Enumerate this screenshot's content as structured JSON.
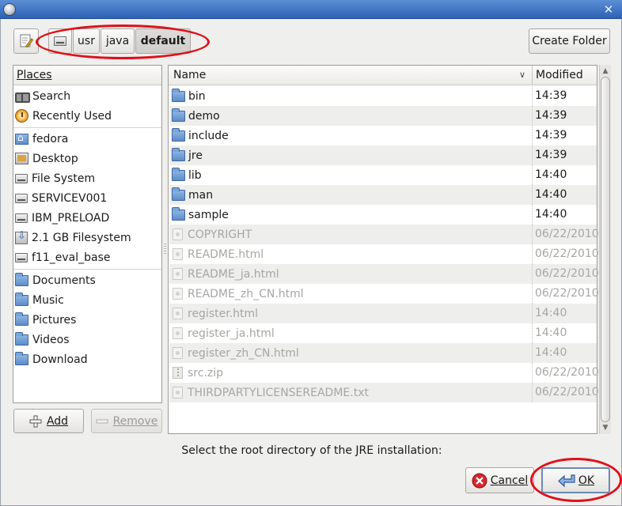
{
  "path_bar": {
    "segments": [
      "usr",
      "java",
      "default"
    ],
    "active": "default"
  },
  "toolbar": {
    "create_folder_label": "Create Folder"
  },
  "places": {
    "header": "Places",
    "items": [
      {
        "label": "Search",
        "icon": "search-icon"
      },
      {
        "label": "Recently Used",
        "icon": "recently-used-icon"
      },
      {
        "label": "fedora",
        "icon": "home-folder-icon"
      },
      {
        "label": "Desktop",
        "icon": "desktop-icon"
      },
      {
        "label": "File System",
        "icon": "drive-icon"
      },
      {
        "label": "SERVICEV001",
        "icon": "drive-icon"
      },
      {
        "label": "IBM_PRELOAD",
        "icon": "drive-icon"
      },
      {
        "label": "2.1 GB Filesystem",
        "icon": "removable-drive-icon"
      },
      {
        "label": "f11_eval_base",
        "icon": "drive-icon"
      },
      {
        "label": "Documents",
        "icon": "folder-icon"
      },
      {
        "label": "Music",
        "icon": "folder-icon"
      },
      {
        "label": "Pictures",
        "icon": "folder-icon"
      },
      {
        "label": "Videos",
        "icon": "folder-icon"
      },
      {
        "label": "Download",
        "icon": "folder-icon"
      }
    ],
    "add_label": "Add",
    "remove_label": "Remove"
  },
  "files": {
    "columns": {
      "name": "Name",
      "modified": "Modified"
    },
    "rows": [
      {
        "name": "bin",
        "modified": "14:39",
        "type": "folder"
      },
      {
        "name": "demo",
        "modified": "14:39",
        "type": "folder"
      },
      {
        "name": "include",
        "modified": "14:39",
        "type": "folder"
      },
      {
        "name": "jre",
        "modified": "14:39",
        "type": "folder"
      },
      {
        "name": "lib",
        "modified": "14:40",
        "type": "folder"
      },
      {
        "name": "man",
        "modified": "14:40",
        "type": "folder"
      },
      {
        "name": "sample",
        "modified": "14:40",
        "type": "folder"
      },
      {
        "name": "COPYRIGHT",
        "modified": "06/22/2010",
        "type": "file"
      },
      {
        "name": "README.html",
        "modified": "06/22/2010",
        "type": "file"
      },
      {
        "name": "README_ja.html",
        "modified": "06/22/2010",
        "type": "file"
      },
      {
        "name": "README_zh_CN.html",
        "modified": "06/22/2010",
        "type": "file"
      },
      {
        "name": "register.html",
        "modified": "14:40",
        "type": "file"
      },
      {
        "name": "register_ja.html",
        "modified": "14:40",
        "type": "file"
      },
      {
        "name": "register_zh_CN.html",
        "modified": "14:40",
        "type": "file"
      },
      {
        "name": "src.zip",
        "modified": "06/22/2010",
        "type": "zip"
      },
      {
        "name": "THIRDPARTYLICENSEREADME.txt",
        "modified": "06/22/2010",
        "type": "file"
      }
    ]
  },
  "message": "Select the root directory of the JRE installation:",
  "actions": {
    "cancel_label": "Cancel",
    "ok_label": "OK"
  },
  "colors": {
    "highlight_ellipse": "#e0101a",
    "titlebar": "#2d62b3"
  }
}
